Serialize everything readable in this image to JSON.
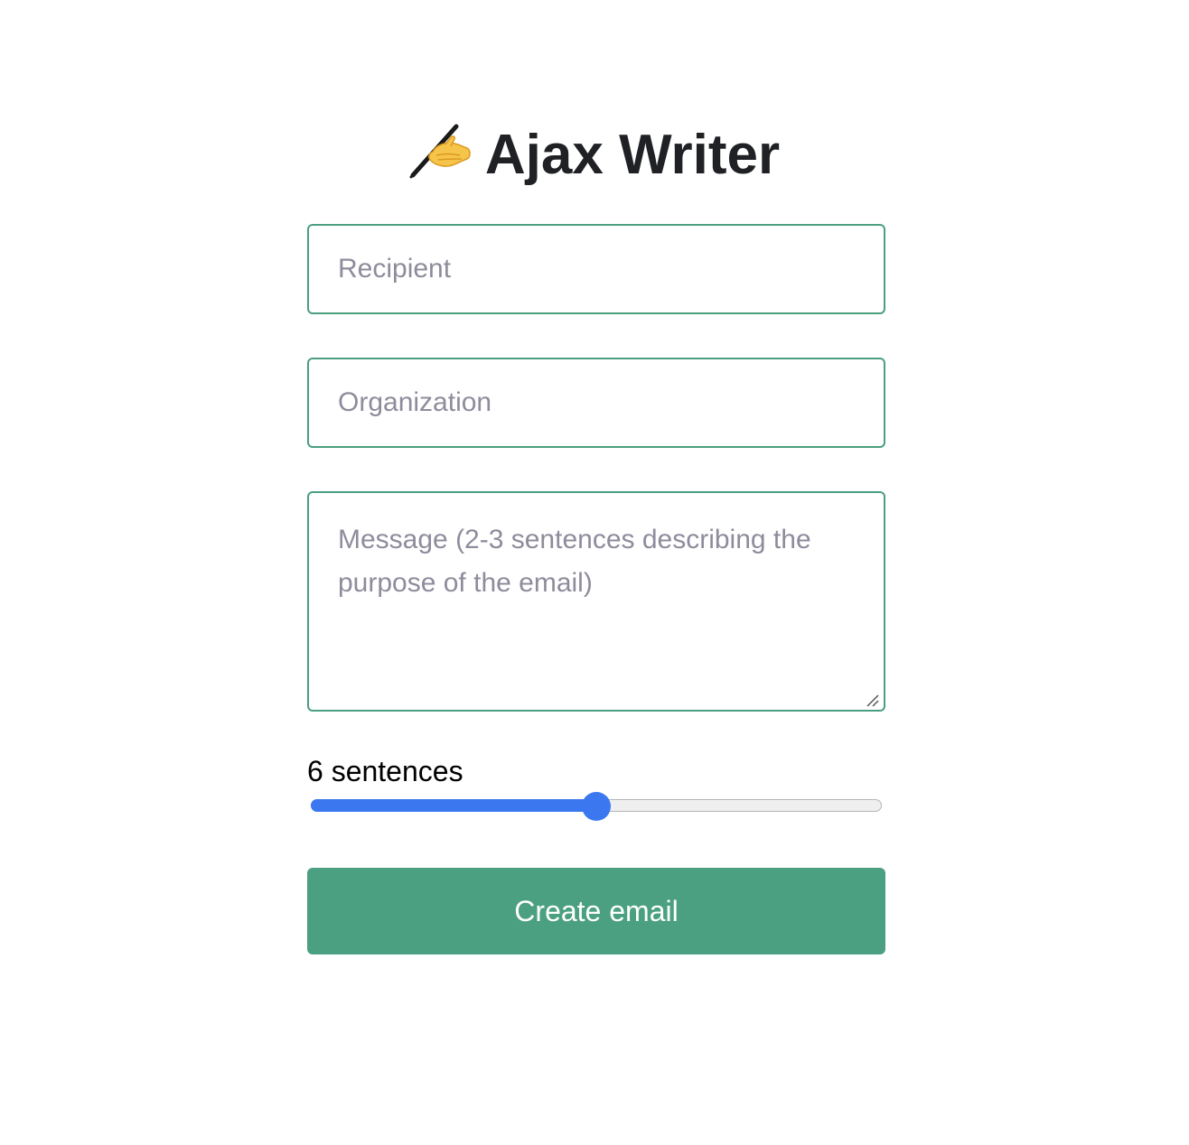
{
  "app": {
    "title": "Ajax Writer",
    "title_icon": "writing-hand-icon"
  },
  "form": {
    "recipient": {
      "placeholder": "Recipient",
      "value": ""
    },
    "organization": {
      "placeholder": "Organization",
      "value": ""
    },
    "message": {
      "placeholder": "Message (2-3 sentences describing the purpose of the email)",
      "value": ""
    },
    "length_slider": {
      "label": "6 sentences",
      "value_fraction": 0.5
    },
    "submit_label": "Create email"
  },
  "colors": {
    "accent_green": "#4ba081",
    "field_border": "#4a9f7f",
    "slider_blue": "#3b78f0",
    "placeholder_gray": "#8e8c9c",
    "title_text": "#1f2124"
  }
}
